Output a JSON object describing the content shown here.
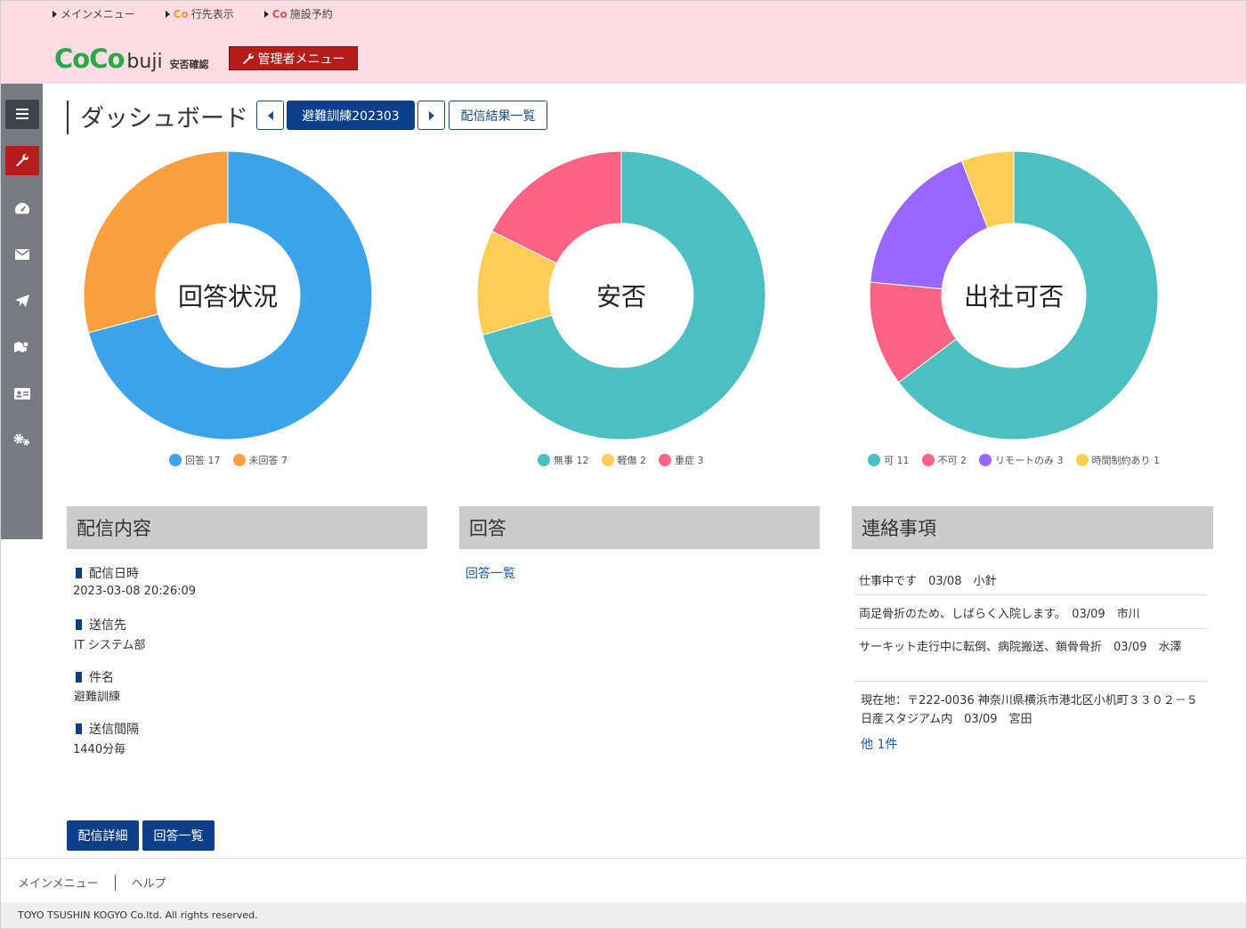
{
  "topnav": {
    "main_menu": "メインメニュー",
    "co_badge": "Co",
    "destination": "行先表示",
    "facility": "施設予約"
  },
  "logo": {
    "coco": "CoCo",
    "buji": "buji",
    "sub": "安否確認"
  },
  "admin_menu": "管理者メニュー",
  "page": {
    "title": "ダッシュボード",
    "event_label": "避難訓練202303",
    "results_button": "配信結果一覧"
  },
  "colors": {
    "blue": "#3ba3e8",
    "orange": "#fba03f",
    "teal": "#4cc0c0",
    "yellow": "#fecd56",
    "pink": "#ff6384",
    "purple": "#9966ff"
  },
  "chart_data": [
    {
      "type": "pie",
      "title": "回答状況",
      "categories": [
        "回答",
        "未回答"
      ],
      "values": [
        17,
        7
      ],
      "colors": [
        "#3ba3e8",
        "#fba03f"
      ],
      "legend": "bottom"
    },
    {
      "type": "pie",
      "title": "安否",
      "categories": [
        "無事",
        "軽傷",
        "重症"
      ],
      "values": [
        12,
        2,
        3
      ],
      "colors": [
        "#4cc0c0",
        "#fecd56",
        "#ff6384"
      ],
      "legend": "bottom"
    },
    {
      "type": "pie",
      "title": "出社可否",
      "categories": [
        "可",
        "不可",
        "リモートのみ",
        "時間制約あり"
      ],
      "values": [
        11,
        2,
        3,
        1
      ],
      "colors": [
        "#4cc0c0",
        "#ff6384",
        "#9966ff",
        "#fecd56"
      ],
      "legend": "bottom"
    }
  ],
  "panels": {
    "delivery": {
      "title": "配信内容",
      "date_label": "配信日時",
      "date_value": "2023-03-08 20:26:09",
      "to_label": "送信先",
      "to_value": "IT システム部",
      "subject_label": "件名",
      "subject_value": "避難訓練",
      "interval_label": "送信間隔",
      "interval_value": "1440分毎"
    },
    "answers": {
      "title": "回答",
      "link": "回答一覧"
    },
    "notices": {
      "title": "連絡事項",
      "items": [
        "仕事中です　03/08　小針",
        "両足骨折のため、しばらく入院します。　03/09　市川",
        "サーキット走行中に転倒、病院搬送、鎖骨骨折　03/09　水澤",
        "現在地：〒222-0036 神奈川県横浜市港北区小机町３３０２－５ 日産スタジアム内　03/09　宮田"
      ],
      "more": "他 1件"
    }
  },
  "buttons": {
    "delivery_detail": "配信詳細",
    "answer_list": "回答一覧"
  },
  "footer": {
    "main_menu": "メインメニュー",
    "help": "ヘルプ",
    "copyright": "TOYO TSUSHIN KOGYO Co.ltd. All rights reserved."
  }
}
